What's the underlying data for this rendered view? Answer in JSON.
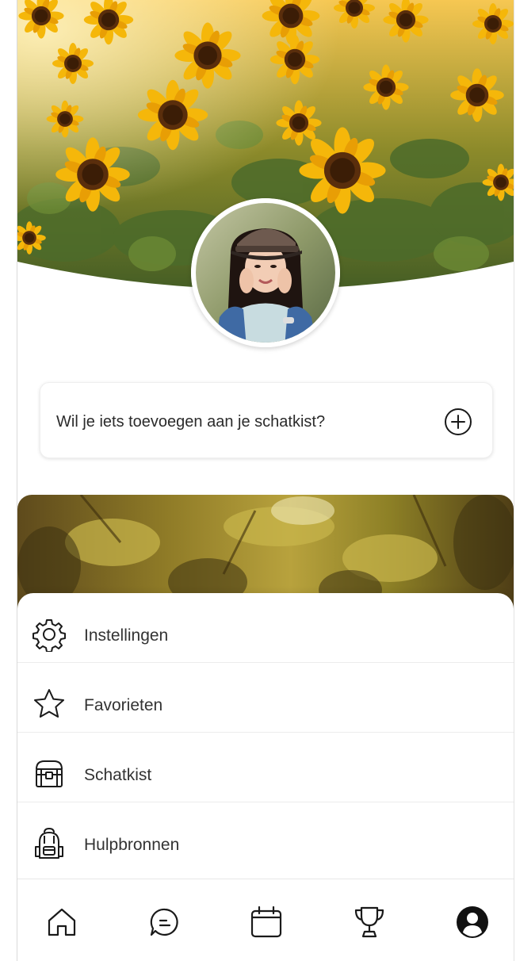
{
  "prompt_card": {
    "text": "Wil je iets toevoegen aan je schatkist?",
    "add_icon": "plus-circle-icon"
  },
  "menu": {
    "items": [
      {
        "label": "Instellingen",
        "icon": "gear-icon"
      },
      {
        "label": "Favorieten",
        "icon": "star-icon"
      },
      {
        "label": "Schatkist",
        "icon": "treasure-chest-icon"
      },
      {
        "label": "Hulpbronnen",
        "icon": "backpack-icon"
      }
    ]
  },
  "bottom_nav": {
    "items": [
      {
        "icon": "home-icon"
      },
      {
        "icon": "chat-icon"
      },
      {
        "icon": "calendar-icon"
      },
      {
        "icon": "trophy-icon"
      },
      {
        "icon": "profile-icon",
        "active": true
      }
    ]
  },
  "colors": {
    "text": "#333333",
    "icon": "#1a1a1a",
    "sunflower_petal": "#f5b70a",
    "sunflower_center": "#5a2e0c"
  }
}
